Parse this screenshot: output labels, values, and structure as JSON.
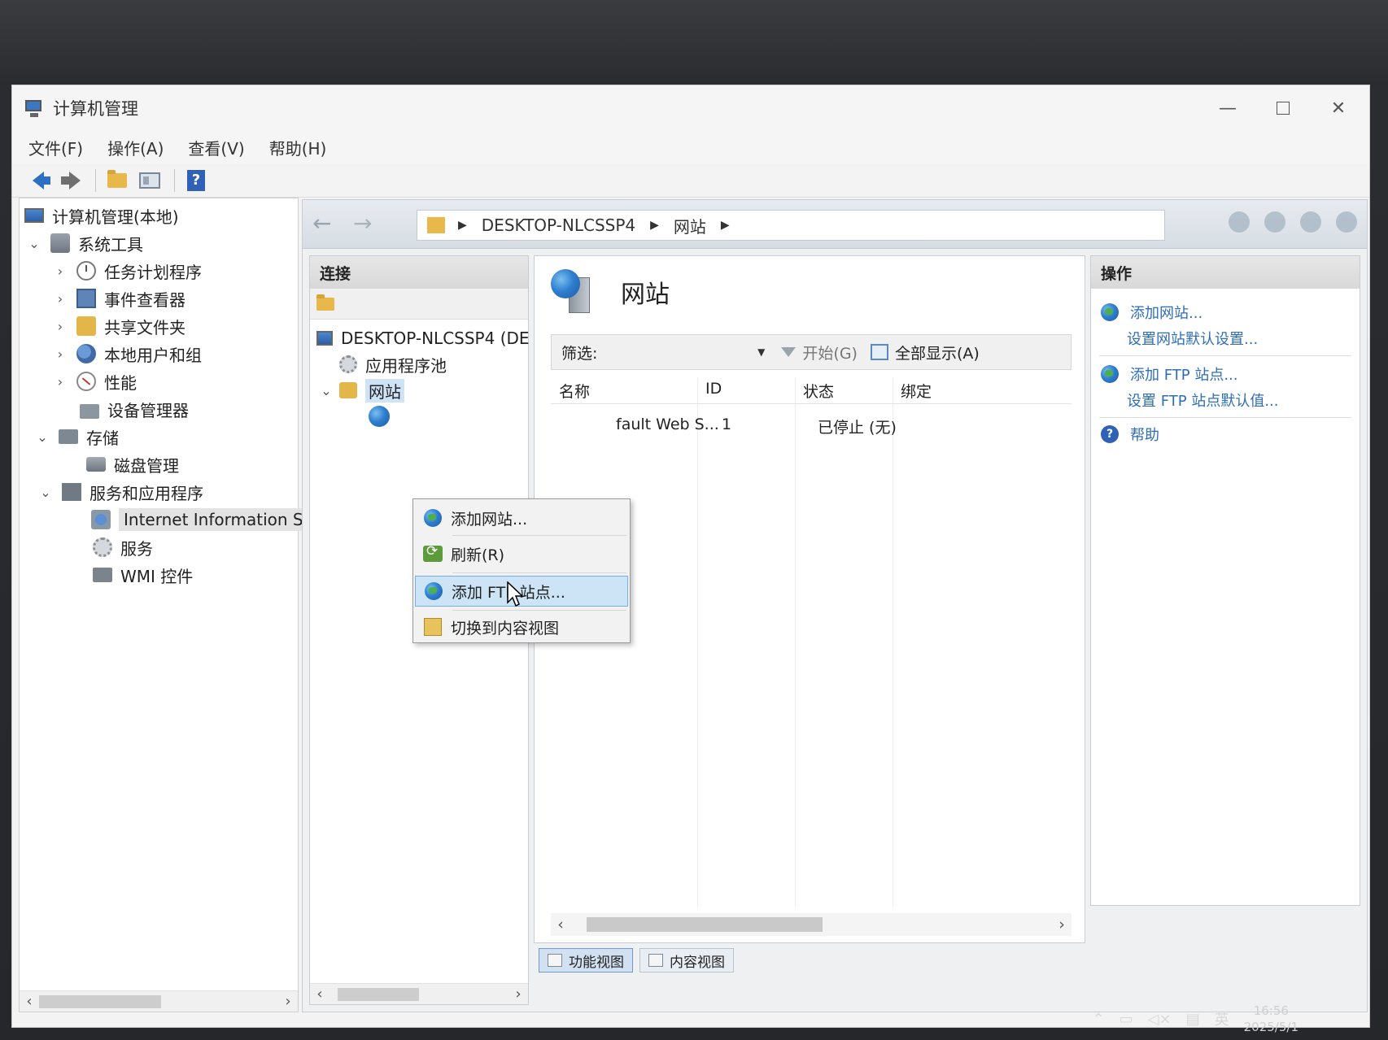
{
  "window": {
    "title": "计算机管理",
    "controls": {
      "minimize": "—",
      "close": "✕"
    }
  },
  "menubar": [
    "文件(F)",
    "操作(A)",
    "查看(V)",
    "帮助(H)"
  ],
  "toolbar": {
    "help_label": "?"
  },
  "left_tree": {
    "root": "计算机管理(本地)",
    "items": [
      {
        "label": "系统工具",
        "expanded": true,
        "icon": "tools-icon"
      },
      {
        "label": "任务计划程序",
        "icon": "clock-icon"
      },
      {
        "label": "事件查看器",
        "icon": "event-viewer-icon"
      },
      {
        "label": "共享文件夹",
        "icon": "shared-folder-icon"
      },
      {
        "label": "本地用户和组",
        "icon": "users-icon"
      },
      {
        "label": "性能",
        "icon": "performance-icon"
      },
      {
        "label": "设备管理器",
        "icon": "device-manager-icon"
      },
      {
        "label": "存储",
        "expanded": true,
        "icon": "storage-icon"
      },
      {
        "label": "磁盘管理",
        "icon": "disk-icon"
      },
      {
        "label": "服务和应用程序",
        "expanded": true,
        "icon": "services-apps-icon"
      },
      {
        "label": "Internet Information S",
        "selected": true,
        "icon": "iis-icon"
      },
      {
        "label": "服务",
        "icon": "services-icon"
      },
      {
        "label": "WMI 控件",
        "icon": "wmi-icon"
      }
    ]
  },
  "iis": {
    "breadcrumb": [
      "DESKTOP-NLCSSP4",
      "网站"
    ],
    "connections": {
      "header": "连接",
      "server": "DESKTOP-NLCSSP4 (DE",
      "app_pools": "应用程序池",
      "sites": "网站"
    },
    "center": {
      "title": "网站",
      "filter_label": "筛选:",
      "start_label": "开始(G)",
      "show_all_label": "全部显示(A)",
      "columns": [
        "名称",
        "ID",
        "状态",
        "绑定"
      ],
      "rows": [
        {
          "name": "fault Web S...",
          "id": "1",
          "status": "已停止 (无)",
          "binding": ""
        }
      ]
    },
    "view_tabs": [
      "功能视图",
      "内容视图"
    ],
    "actions": {
      "header": "操作",
      "add_site": "添加网站...",
      "set_site_defaults": "设置网站默认设置...",
      "add_ftp": "添加 FTP 站点...",
      "set_ftp_defaults": "设置 FTP 站点默认值...",
      "help": "帮助"
    },
    "context_menu": [
      {
        "label": "添加网站...",
        "icon": "add-site-globe-icon"
      },
      {
        "label": "刷新(R)",
        "icon": "refresh-icon"
      },
      {
        "label": "添加 FTP 站点...",
        "icon": "add-ftp-globe-icon",
        "hover": true
      },
      {
        "label": "切换到内容视图",
        "icon": "content-view-icon"
      }
    ]
  },
  "taskbar": {
    "ime": "英",
    "time": "16:56",
    "date": "2025/5/1"
  }
}
